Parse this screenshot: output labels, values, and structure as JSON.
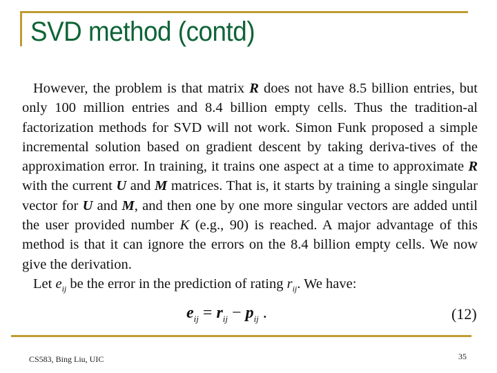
{
  "slide": {
    "title": "SVD method (contd)",
    "paragraph1": {
      "t1": "However, the problem is that matrix ",
      "R1": "R",
      "t2": " does not have 8.5 billion entries, but only 100 million entries and 8.4 billion empty cells. Thus the tradition-al factorization methods for SVD will not work. Simon Funk proposed a simple incremental solution based on gradient descent by taking deriva-tives of the approximation error. In training, it trains one aspect at a time to approximate ",
      "R2": "R",
      "t3": " with the current ",
      "U1": "U",
      "t4": " and ",
      "M1": "M",
      "t5": " matrices. That is, it starts by training a single singular vector for ",
      "U2": "U",
      "t6": " and ",
      "M2": "M",
      "t7": ", and then one by one more singular vectors are added until the user provided number ",
      "K": "K",
      "t8": " (e.g., 90) is reached. A major advantage of this method is that it can ignore the errors on the 8.4 billion empty cells. We now give the derivation."
    },
    "paragraph2": {
      "t1": "Let ",
      "e": "e",
      "e_sub": "ij",
      "t2": " be the error in the prediction of rating ",
      "r": "r",
      "r_sub": "ij",
      "t3": ". We have:"
    },
    "equation": {
      "lhs": "e",
      "lhs_sub": "ij",
      "eq": " = ",
      "term1": "r",
      "term1_sub": "ij",
      "op": " − ",
      "term2": "p",
      "term2_sub": "ij",
      "end": " .",
      "number": "(12)"
    },
    "footer": {
      "source": "CS583, Bing Liu, UIC",
      "page_number": "35"
    }
  }
}
